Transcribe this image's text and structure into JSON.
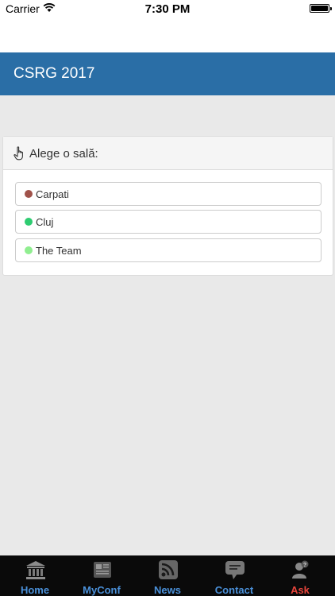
{
  "status_bar": {
    "carrier": "Carrier",
    "time": "7:30 PM"
  },
  "header": {
    "title": "CSRG 2017"
  },
  "panel": {
    "title": "Alege o sală:",
    "rooms": [
      {
        "label": "Carpati",
        "color": "#a0524a"
      },
      {
        "label": "Cluj",
        "color": "#2ecc71"
      },
      {
        "label": "The Team",
        "color": "#90ee90"
      }
    ]
  },
  "tab_bar": {
    "tabs": [
      {
        "label": "Home",
        "icon": "bank-icon",
        "color": "#4a90d9"
      },
      {
        "label": "MyConf",
        "icon": "newspaper-icon",
        "color": "#4a90d9"
      },
      {
        "label": "News",
        "icon": "rss-icon",
        "color": "#4a90d9"
      },
      {
        "label": "Contact",
        "icon": "speech-bubble-icon",
        "color": "#4a90d9"
      },
      {
        "label": "Ask",
        "icon": "user-question-icon",
        "color": "#e8453c"
      }
    ]
  }
}
